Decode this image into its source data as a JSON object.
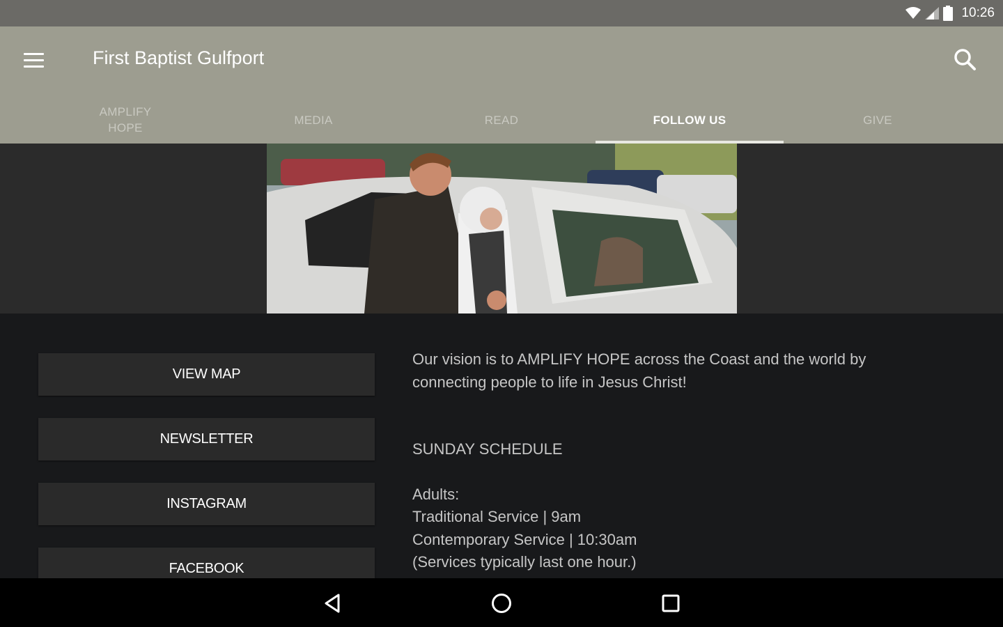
{
  "status_bar": {
    "time": "10:26",
    "icons": [
      "wifi-icon",
      "signal-icon",
      "battery-icon"
    ]
  },
  "app_bar": {
    "title": "First Baptist Gulfport",
    "menu_icon": "hamburger-menu-icon",
    "search_icon": "search-icon",
    "background": "#9d9d90"
  },
  "tabs": [
    {
      "label": "AMPLIFY\nHOPE",
      "active": false
    },
    {
      "label": "MEDIA",
      "active": false
    },
    {
      "label": "READ",
      "active": false
    },
    {
      "label": "FOLLOW US",
      "active": true
    },
    {
      "label": "GIVE",
      "active": false
    }
  ],
  "hero": {
    "image": "photo-man-helping-woman-into-car"
  },
  "buttons": {
    "view_map": "VIEW MAP",
    "newsletter": "NEWSLETTER",
    "instagram": "INSTAGRAM",
    "facebook": "FACEBOOK"
  },
  "info": {
    "vision": "Our vision is to AMPLIFY HOPE across the Coast and the world by connecting people to life in Jesus Christ!",
    "schedule_heading": "SUNDAY SCHEDULE",
    "adults_label": "Adults:",
    "lines": [
      "Traditional Service | 9am",
      "Contemporary Service | 10:30am",
      "(Services typically last one hour.)"
    ]
  },
  "nav_bar": {
    "icons": [
      "back-icon",
      "home-icon",
      "recents-icon"
    ]
  }
}
